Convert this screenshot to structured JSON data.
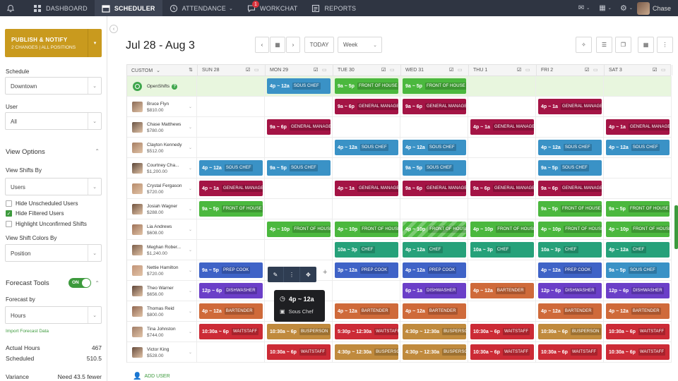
{
  "nav": {
    "items": [
      {
        "label": "DASHBOARD",
        "icon": "dashboard-icon"
      },
      {
        "label": "SCHEDULER",
        "icon": "calendar-icon",
        "active": true
      },
      {
        "label": "ATTENDANCE",
        "icon": "clock-icon"
      },
      {
        "label": "WORKCHAT",
        "icon": "chat-icon",
        "badge": "1"
      },
      {
        "label": "REPORTS",
        "icon": "reports-icon"
      }
    ],
    "user_name": "Chase"
  },
  "sidebar": {
    "publish_label": "PUBLISH & NOTIFY",
    "publish_sub": "2 CHANGES | ALL POSITIONS",
    "schedule_label": "Schedule",
    "schedule_value": "Downtown",
    "user_label": "User",
    "user_value": "All",
    "view_options_label": "View Options",
    "view_shifts_by_label": "View Shifts By",
    "view_shifts_by_value": "Users",
    "checkboxes": [
      {
        "label": "Hide Unscheduled Users",
        "checked": false
      },
      {
        "label": "Hide Filtered Users",
        "checked": true
      },
      {
        "label": "Highlight Unconfirmed Shifts",
        "checked": false
      }
    ],
    "shift_colors_label": "View Shift Colors By",
    "shift_colors_value": "Position",
    "forecast_tools_label": "Forecast Tools",
    "forecast_toggle": "ON",
    "forecast_by_label": "Forecast by",
    "forecast_by_value": "Hours",
    "import_link": "Import Forecast Data",
    "actual_hours_label": "Actual Hours",
    "actual_hours_value": "467",
    "scheduled_label": "Scheduled",
    "scheduled_value": "510.5",
    "variance_label": "Variance",
    "variance_value": "Need 43.5 fewer"
  },
  "header": {
    "date_range": "Jul 28 - Aug 3",
    "today_label": "TODAY",
    "view_value": "Week"
  },
  "grid": {
    "first_col_label": "CUSTOM",
    "days": [
      "SUN 28",
      "MON 29",
      "TUE 30",
      "WED 31",
      "THU 1",
      "FRI 2",
      "SAT 3"
    ],
    "add_user_label": "ADD USER",
    "rows": [
      {
        "name": "OpenShifts",
        "wage": "",
        "open": true,
        "shifts": [
          null,
          [
            "4p ~ 12a",
            "SOUS CHEF",
            "sous"
          ],
          [
            "9a ~ 5p",
            "FRONT OF HOUSE",
            "foh"
          ],
          [
            "9a ~ 5p",
            "FRONT OF HOUSE",
            "foh"
          ],
          null,
          null,
          null
        ]
      },
      {
        "name": "Bruce Flyn",
        "wage": "$810.00",
        "shifts": [
          null,
          null,
          [
            "9a ~ 6p",
            "GENERAL MANAGER",
            "gm"
          ],
          [
            "9a ~ 6p",
            "GENERAL MANAGER",
            "gm"
          ],
          null,
          [
            "4p ~ 1a",
            "GENERAL MANAGER",
            "gm"
          ],
          null
        ]
      },
      {
        "name": "Chase Matthews",
        "wage": "$780.00",
        "shifts": [
          null,
          [
            "9a ~ 6p",
            "GENERAL MANAGER",
            "gm"
          ],
          null,
          null,
          [
            "4p ~ 1a",
            "GENERAL MANAGER",
            "gm"
          ],
          null,
          [
            "4p ~ 1a",
            "GENERAL MANAGER",
            "gm"
          ]
        ]
      },
      {
        "name": "Clayton Kennedy",
        "wage": "$512.00",
        "shifts": [
          null,
          null,
          [
            "4p ~ 12a",
            "SOUS CHEF",
            "sous"
          ],
          [
            "4p ~ 12a",
            "SOUS CHEF",
            "sous"
          ],
          null,
          [
            "4p ~ 12a",
            "SOUS CHEF",
            "sous"
          ],
          [
            "4p ~ 12a",
            "SOUS CHEF",
            "sous"
          ]
        ]
      },
      {
        "name": "Courtney Cha...",
        "wage": "$1,200.00",
        "shifts": [
          [
            "4p ~ 12a",
            "SOUS CHEF",
            "sous"
          ],
          [
            "9a ~ 5p",
            "SOUS CHEF",
            "sous"
          ],
          null,
          [
            "9a ~ 5p",
            "SOUS CHEF",
            "sous"
          ],
          null,
          [
            "9a ~ 5p",
            "SOUS CHEF",
            "sous"
          ],
          null
        ]
      },
      {
        "name": "Crystal Fergason",
        "wage": "$720.00",
        "shifts": [
          [
            "4p ~ 1a",
            "GENERAL MANAGER",
            "gm"
          ],
          null,
          [
            "4p ~ 1a",
            "GENERAL MANAGER",
            "gm"
          ],
          [
            "9a ~ 6p",
            "GENERAL MANAGER",
            "gm"
          ],
          [
            "9a ~ 6p",
            "GENERAL MANAGER",
            "gm"
          ],
          [
            "9a ~ 6p",
            "GENERAL MANAGER",
            "gm"
          ],
          null
        ]
      },
      {
        "name": "Josiah Wagner",
        "wage": "$288.00",
        "shifts": [
          [
            "9a ~ 5p",
            "FRONT OF HOUSE",
            "foh"
          ],
          null,
          null,
          null,
          null,
          [
            "9a ~ 5p",
            "FRONT OF HOUSE",
            "foh"
          ],
          [
            "9a ~ 5p",
            "FRONT OF HOUSE",
            "foh"
          ]
        ]
      },
      {
        "name": "Lia Andrews",
        "wage": "$608.00",
        "shifts": [
          null,
          [
            "4p ~ 10p",
            "FRONT OF HOUSE",
            "foh"
          ],
          [
            "4p ~ 10p",
            "FRONT OF HOUSE",
            "foh"
          ],
          [
            "4p ~ 10p",
            "FRONT OF HOUSE",
            "foh-striped"
          ],
          [
            "4p ~ 10p",
            "FRONT OF HOUSE",
            "foh"
          ],
          [
            "4p ~ 10p",
            "FRONT OF HOUSE",
            "foh"
          ],
          [
            "4p ~ 10p",
            "FRONT OF HOUSE",
            "foh"
          ]
        ]
      },
      {
        "name": "Meghan Rober...",
        "wage": "$1,240.00",
        "shifts": [
          null,
          null,
          [
            "10a ~ 3p",
            "CHEF",
            "chef"
          ],
          [
            "4p ~ 12a",
            "CHEF",
            "chef"
          ],
          [
            "10a ~ 3p",
            "CHEF",
            "chef"
          ],
          [
            "10a ~ 3p",
            "CHEF",
            "chef"
          ],
          [
            "4p ~ 12a",
            "CHEF",
            "chef"
          ]
        ]
      },
      {
        "name": "Nettie Hamilton",
        "wage": "$720.00",
        "shifts": [
          [
            "9a ~ 5p",
            "PREP COOK",
            "prep"
          ],
          null,
          [
            "3p ~ 12a",
            "PREP COOK",
            "prep"
          ],
          [
            "4p ~ 12a",
            "PREP COOK",
            "prep"
          ],
          null,
          [
            "4p ~ 12a",
            "PREP COOK",
            "prep"
          ],
          [
            "9a ~ 5p",
            "SOUS CHEF",
            "sous"
          ]
        ]
      },
      {
        "name": "Theo Warner",
        "wage": "$656.00",
        "shifts": [
          [
            "12p ~ 6p",
            "DISHWASHER",
            "dish"
          ],
          null,
          null,
          [
            "6p ~ 1a",
            "DISHWASHER",
            "dish"
          ],
          [
            "4p ~ 12a",
            "BARTENDER",
            "bar"
          ],
          [
            "12p ~ 6p",
            "DISHWASHER",
            "dish"
          ],
          [
            "12p ~ 6p",
            "DISHWASHER",
            "dish"
          ]
        ]
      },
      {
        "name": "Thomas Reid",
        "wage": "$800.00",
        "shifts": [
          [
            "4p ~ 12a",
            "BARTENDER",
            "bar"
          ],
          null,
          [
            "4p ~ 12a",
            "BARTENDER",
            "bar"
          ],
          [
            "4p ~ 12a",
            "BARTENDER",
            "bar"
          ],
          null,
          [
            "4p ~ 12a",
            "BARTENDER",
            "bar"
          ],
          [
            "4p ~ 12a",
            "BARTENDER",
            "bar"
          ]
        ]
      },
      {
        "name": "Tina Johnston",
        "wage": "$744.00",
        "shifts": [
          [
            "10:30a ~ 6p",
            "WAITSTAFF",
            "wait"
          ],
          [
            "10:30a ~ 6p",
            "BUSPERSON",
            "bus"
          ],
          [
            "5:30p ~ 12:30a",
            "WAITSTAFF",
            "wait"
          ],
          [
            "4:30p ~ 12:30a",
            "BUSPERSON",
            "bus"
          ],
          [
            "10:30a ~ 6p",
            "WAITSTAFF",
            "wait"
          ],
          [
            "10:30a ~ 6p",
            "BUSPERSON",
            "bus"
          ],
          [
            "10:30a ~ 6p",
            "WAITSTAFF",
            "wait"
          ]
        ]
      },
      {
        "name": "Victor King",
        "wage": "$528.00",
        "shifts": [
          null,
          [
            "10:30a ~ 6p",
            "WAITSTAFF",
            "wait"
          ],
          [
            "4:30p ~ 12:30a",
            "BUSPERSON",
            "bus"
          ],
          [
            "4:30p ~ 12:30a",
            "BUSPERSON",
            "bus"
          ],
          [
            "10:30a ~ 6p",
            "WAITSTAFF",
            "wait"
          ],
          [
            "10:30a ~ 6p",
            "WAITSTAFF",
            "wait"
          ],
          [
            "10:30a ~ 6p",
            "WAITSTAFF",
            "wait"
          ]
        ]
      }
    ]
  },
  "tooltip": {
    "time": "4p ~ 12a",
    "position": "Sous Chef"
  },
  "colors": {
    "sous": "#3a92c6",
    "foh": "#4bb83e",
    "gm": "#a41445",
    "chef": "#26a17a",
    "prep": "#3f63c7",
    "dish": "#6b3fc8",
    "bar": "#cf6a3a",
    "wait": "#cc2b36",
    "bus": "#c08a3d",
    "foh-striped": "#4bb83e",
    "publish": "#c99a1e",
    "nav": "#2f3542"
  },
  "avatar_colors": [
    "#8a6a55",
    "#6a5445",
    "#a57d62",
    "#5b4638",
    "#b68a6a",
    "#70533f",
    "#9c6f55",
    "#7b5d49",
    "#c19377",
    "#5e4437",
    "#8f6650",
    "#a07c66",
    "#664b3c"
  ]
}
